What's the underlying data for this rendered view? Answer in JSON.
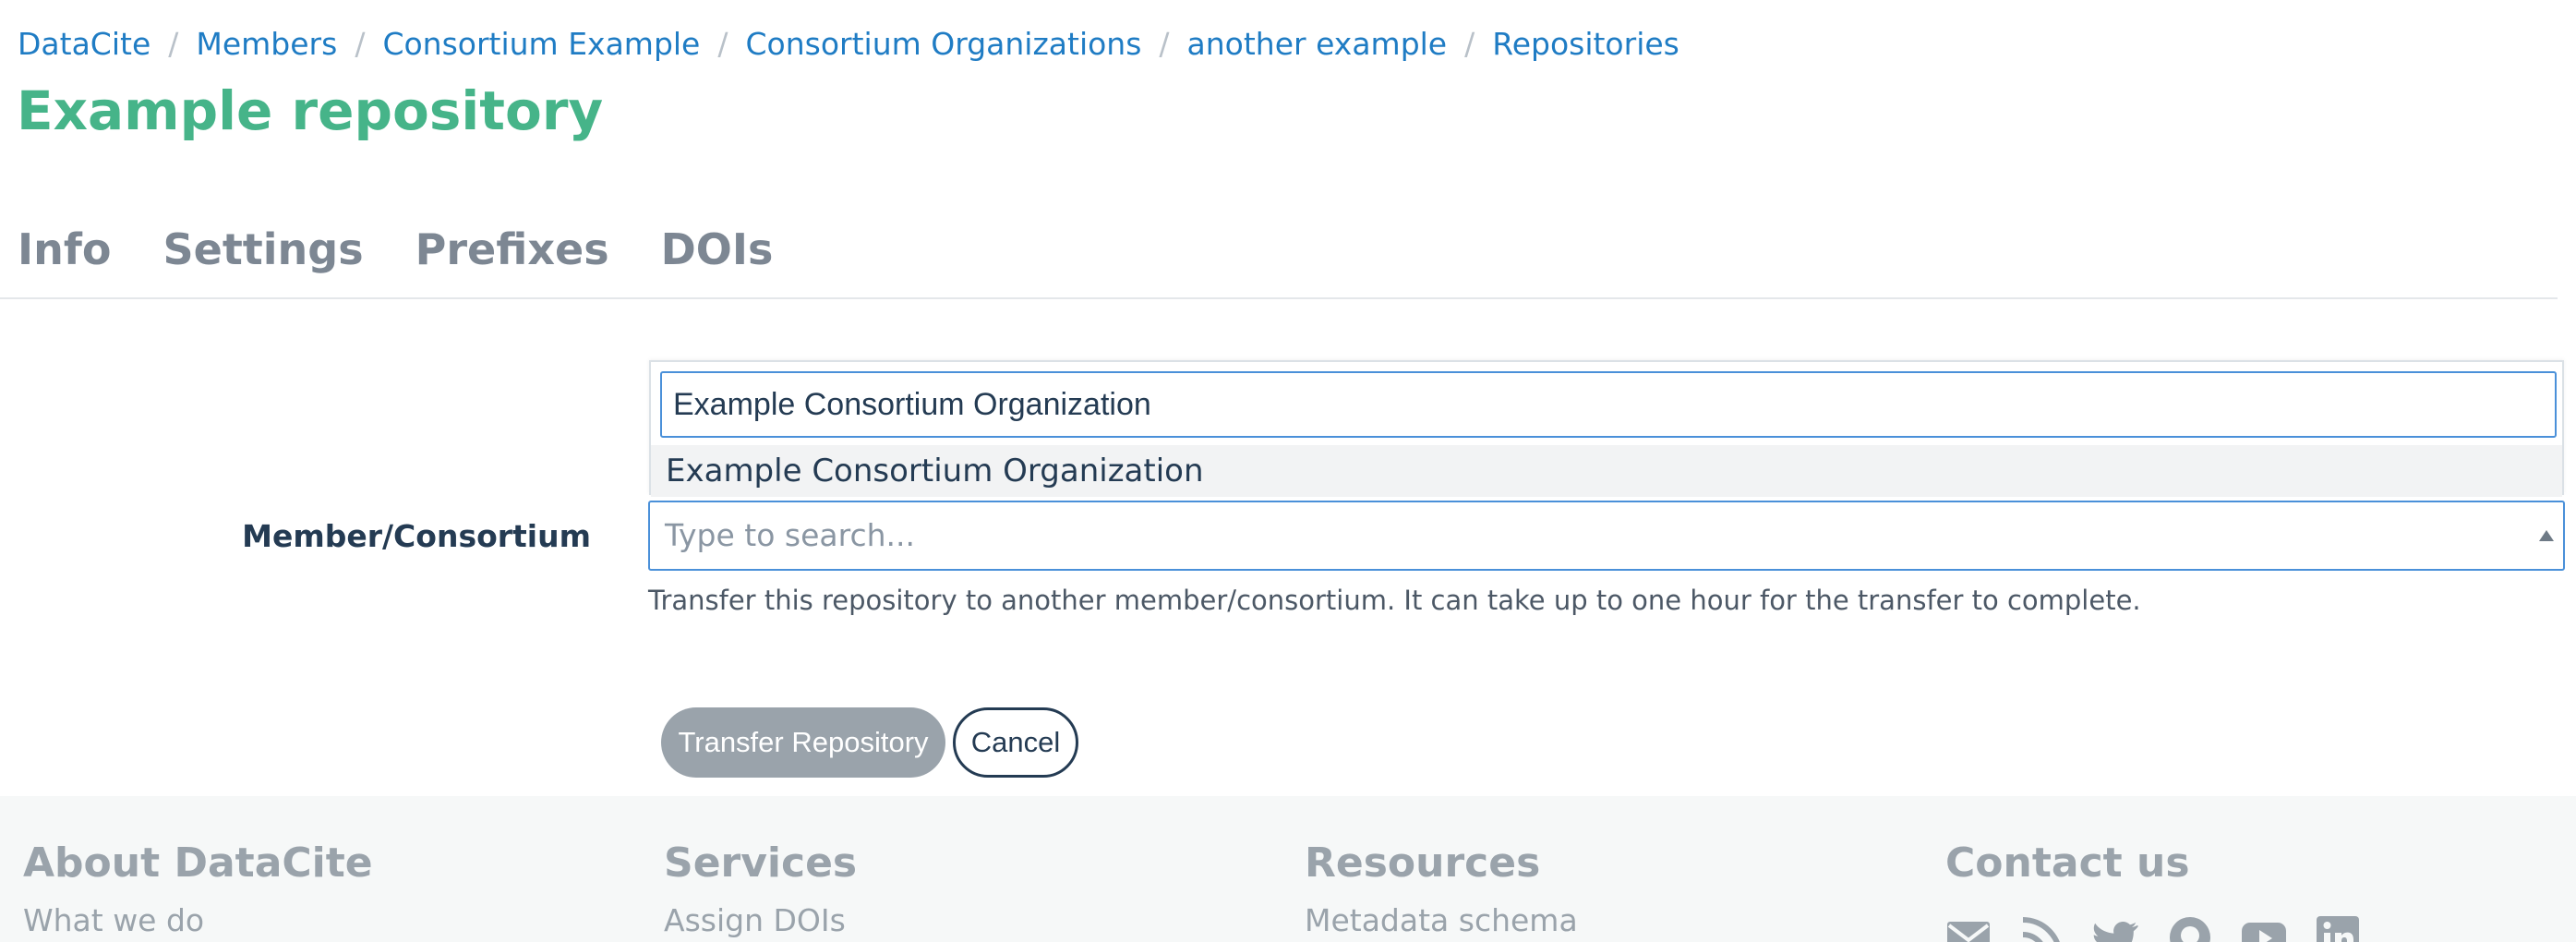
{
  "breadcrumb": {
    "items": [
      "DataCite",
      "Members",
      "Consortium Example",
      "Consortium Organizations",
      "another example",
      "Repositories"
    ],
    "separator": "/"
  },
  "page": {
    "title": "Example repository"
  },
  "tabs": [
    "Info",
    "Settings",
    "Prefixes",
    "DOIs"
  ],
  "form": {
    "label": "Member/Consortium",
    "dropdown": {
      "search_value": "Example Consortium Organization",
      "options": [
        "Example Consortium Organization"
      ]
    },
    "select_placeholder": "Type to search...",
    "help_text": "Transfer this repository to another member/consortium. It can take up to one hour for the transfer to complete.",
    "submit_label": "Transfer Repository",
    "cancel_label": "Cancel"
  },
  "footer": {
    "about": {
      "heading": "About DataCite",
      "link": "What we do"
    },
    "services": {
      "heading": "Services",
      "link": "Assign DOIs"
    },
    "resources": {
      "heading": "Resources",
      "link": "Metadata schema"
    },
    "contact": {
      "heading": "Contact us",
      "icons": [
        "email-icon",
        "rss-icon",
        "twitter-icon",
        "github-icon",
        "youtube-icon",
        "linkedin-icon"
      ]
    }
  },
  "colors": {
    "link": "#1f7cc4",
    "title": "#46b489",
    "tab": "#7d8793",
    "focus_border": "#4a90d9",
    "disabled_button": "#9aa3ab",
    "footer_bg": "#f6f8f8"
  }
}
